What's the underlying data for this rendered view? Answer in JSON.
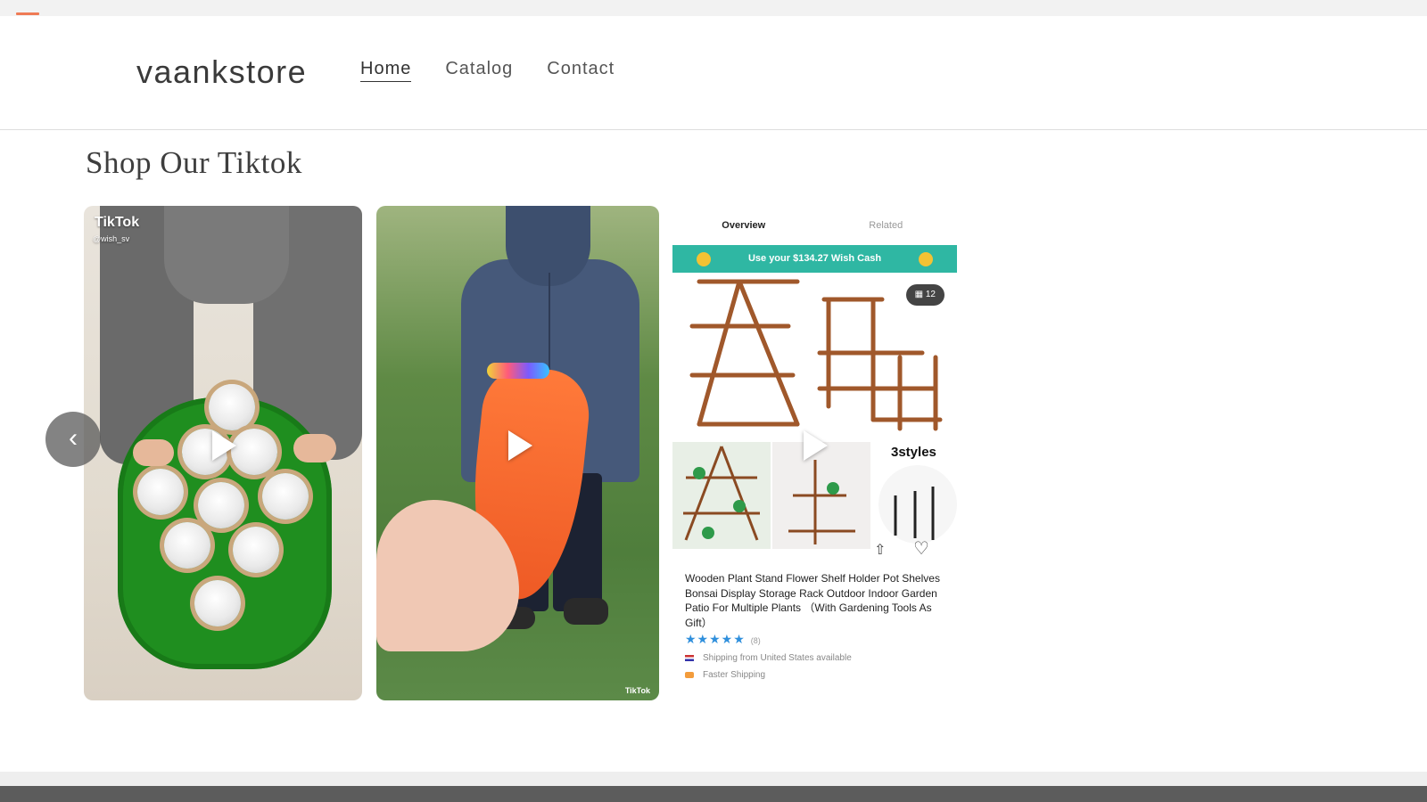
{
  "store": {
    "name": "vaankstore"
  },
  "nav": {
    "items": [
      {
        "label": "Home",
        "active": true
      },
      {
        "label": "Catalog",
        "active": false
      },
      {
        "label": "Contact",
        "active": false
      }
    ]
  },
  "section": {
    "title": "Shop Our Tiktok"
  },
  "videos": [
    {
      "overlay_logo": "TikTok",
      "overlay_handle": "@wish_sv",
      "icon": "play-icon"
    },
    {
      "overlay_logo": "TikTok",
      "icon": "play-icon"
    },
    {
      "icon": "play-icon",
      "tabs": [
        "Overview",
        "Related"
      ],
      "banner": "Use your $134.27 Wish Cash",
      "image_count": "12",
      "styles_label": "3styles",
      "product_title": "Wooden Plant Stand Flower Shelf Holder Pot Shelves Bonsai Display Storage Rack Outdoor Indoor Garden Patio For Multiple Plants （With Gardening Tools As Gift）",
      "rating_stars": "★★★★★",
      "rating_count": "(8)",
      "shipping": "Shipping from United States available",
      "fast_shipping": "Faster Shipping"
    }
  ],
  "carousel": {
    "prev_icon": "chevron-left-icon"
  },
  "colors": {
    "accent": "#ef7b55",
    "banner": "#2fb7a3",
    "stars": "#2f8fdc"
  }
}
